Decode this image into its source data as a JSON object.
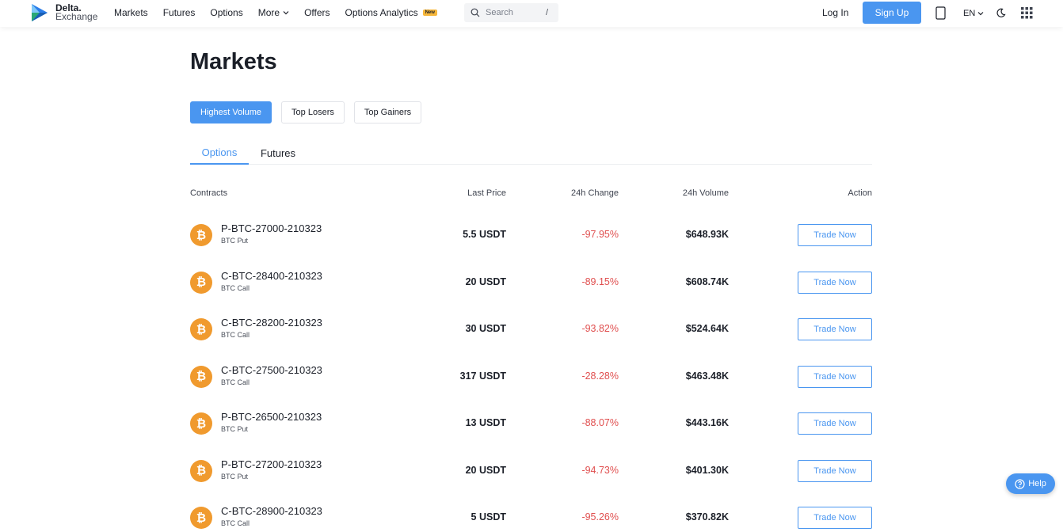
{
  "brand": {
    "line1": "Delta.",
    "line2": "Exchange"
  },
  "nav": {
    "markets": "Markets",
    "futures": "Futures",
    "options": "Options",
    "more": "More",
    "offers": "Offers",
    "options_analytics": "Options Analytics",
    "new_badge": "New"
  },
  "search": {
    "placeholder": "Search",
    "shortcut": "/"
  },
  "auth": {
    "login": "Log In",
    "signup": "Sign Up"
  },
  "lang": "EN",
  "page": {
    "title": "Markets"
  },
  "filters": {
    "highest_volume": "Highest Volume",
    "top_losers": "Top Losers",
    "top_gainers": "Top Gainers"
  },
  "tabs": {
    "options": "Options",
    "futures": "Futures"
  },
  "table": {
    "headers": {
      "contracts": "Contracts",
      "last_price": "Last Price",
      "change": "24h Change",
      "volume": "24h Volume",
      "action": "Action"
    },
    "trade_label": "Trade Now",
    "rows": [
      {
        "symbol": "P-BTC-27000-210323",
        "sub": "BTC Put",
        "price": "5.5 USDT",
        "change": "-97.95%",
        "volume": "$648.93K"
      },
      {
        "symbol": "C-BTC-28400-210323",
        "sub": "BTC Call",
        "price": "20 USDT",
        "change": "-89.15%",
        "volume": "$608.74K"
      },
      {
        "symbol": "C-BTC-28200-210323",
        "sub": "BTC Call",
        "price": "30 USDT",
        "change": "-93.82%",
        "volume": "$524.64K"
      },
      {
        "symbol": "C-BTC-27500-210323",
        "sub": "BTC Call",
        "price": "317 USDT",
        "change": "-28.28%",
        "volume": "$463.48K"
      },
      {
        "symbol": "P-BTC-26500-210323",
        "sub": "BTC Put",
        "price": "13 USDT",
        "change": "-88.07%",
        "volume": "$443.16K"
      },
      {
        "symbol": "P-BTC-27200-210323",
        "sub": "BTC Put",
        "price": "20 USDT",
        "change": "-94.73%",
        "volume": "$401.30K"
      },
      {
        "symbol": "C-BTC-28900-210323",
        "sub": "BTC Call",
        "price": "5 USDT",
        "change": "-95.26%",
        "volume": "$370.82K"
      }
    ]
  },
  "help": "Help",
  "colors": {
    "accent": "#4a96f0",
    "negative": "#e04f4f",
    "btc": "#f09a2e",
    "badge": "#f6b73c"
  }
}
